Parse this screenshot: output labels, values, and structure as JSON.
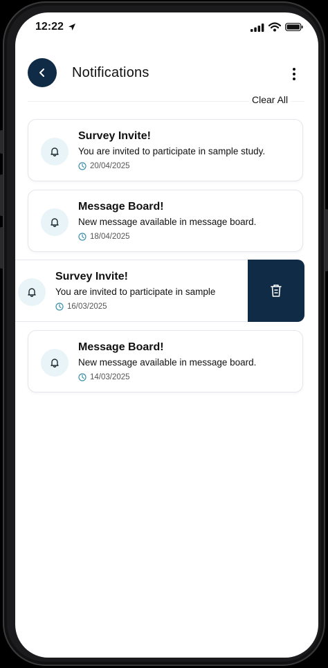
{
  "status_bar": {
    "time": "12:22"
  },
  "header": {
    "title": "Notifications",
    "clear_all": "Clear All"
  },
  "notifications": [
    {
      "title": "Survey Invite!",
      "message": "You are invited to participate in sample study.",
      "date": "20/04/2025"
    },
    {
      "title": "Message Board!",
      "message": "New message available in message board.",
      "date": "18/04/2025"
    },
    {
      "title": "Survey Invite!",
      "message": "You are invited to participate in sample",
      "date": "16/03/2025",
      "swiped": true
    },
    {
      "title": "Message Board!",
      "message": "New message available in message board.",
      "date": "14/03/2025"
    }
  ],
  "colors": {
    "accent": "#0f2b45",
    "icon_bg": "#e8f4f7",
    "icon_stroke": "#3d8fa8"
  },
  "icons": {
    "back": "chevron-left-icon",
    "menu": "kebab-menu-icon",
    "bell": "bell-icon",
    "clock": "clock-icon",
    "delete": "trash-icon"
  }
}
